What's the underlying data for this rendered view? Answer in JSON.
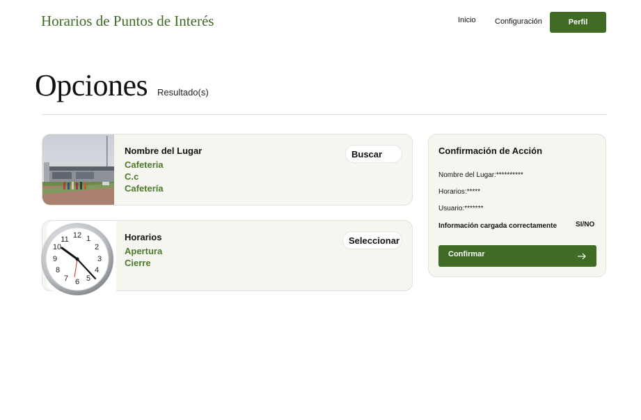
{
  "header": {
    "brand": "Horarios de Puntos de Interés",
    "nav": {
      "inicio": "Inicio",
      "configuracion": "Configuración",
      "perfil": "Perfil"
    }
  },
  "page": {
    "title": "Opciones",
    "subtitle": "Resultado(s)"
  },
  "lugar_card": {
    "heading": "Nombre del Lugar",
    "lines": [
      "Cafeteria",
      "C.c",
      "Cafetería"
    ],
    "button": "Buscar",
    "image": "campus-building-photo"
  },
  "horarios_card": {
    "heading": "Horarios",
    "lines": [
      "Apertura",
      "Cierre"
    ],
    "button": "Seleccionar",
    "image": "clock-icon"
  },
  "confirm_card": {
    "title": "Confirmación de Acción",
    "lugar": "Nombre del Lugar:**********",
    "horarios": "Horarios:*****",
    "usuario": "Usuario:*******",
    "status": "Información cargada correctamente",
    "si_no": "SI/NO",
    "button": "Confirmar",
    "button_icon": "arrow-right-icon"
  },
  "colors": {
    "accent": "#3f6b24",
    "accent_text": "#4a7a2b",
    "card_bg": "#f6f6f0"
  }
}
